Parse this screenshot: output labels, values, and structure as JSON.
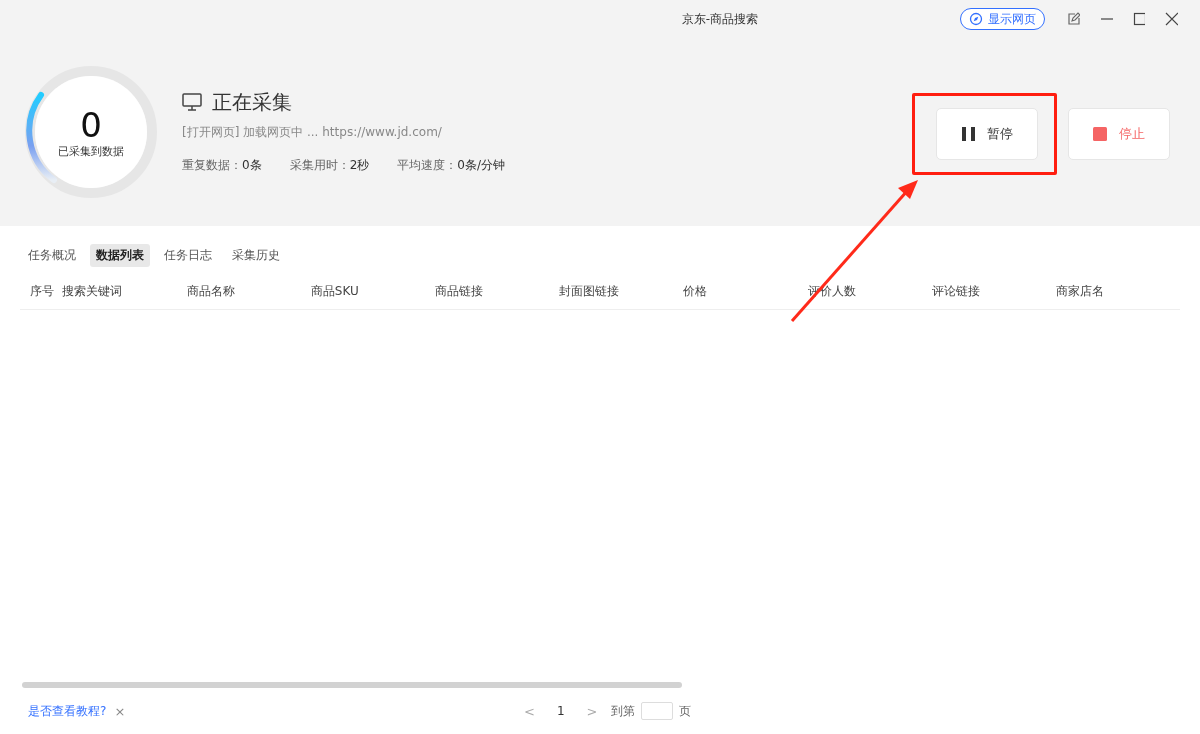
{
  "window": {
    "title": "京东-商品搜索",
    "show_page_button": "显示网页"
  },
  "status": {
    "count": "0",
    "count_label": "已采集到数据",
    "title": "正在采集",
    "detail": "[打开网页] 加载网页中 ... https://www.jd.com/",
    "stats": [
      {
        "label": "重复数据：",
        "value": "0条"
      },
      {
        "label": "采集用时：",
        "value": "2秒"
      },
      {
        "label": "平均速度：",
        "value": "0条/分钟"
      }
    ]
  },
  "actions": [
    {
      "kind": "pause",
      "label": "暂停",
      "highlighted": true
    },
    {
      "kind": "stop",
      "label": "停止",
      "highlighted": false
    }
  ],
  "tabs": [
    {
      "label": "任务概况",
      "selected": false
    },
    {
      "label": "数据列表",
      "selected": true
    },
    {
      "label": "任务日志",
      "selected": false
    },
    {
      "label": "采集历史",
      "selected": false
    }
  ],
  "table": {
    "columns": [
      "序号",
      "搜索关键词",
      "商品名称",
      "商品SKU",
      "商品链接",
      "封面图链接",
      "价格",
      "评价人数",
      "评论链接",
      "商家店名"
    ]
  },
  "footer": {
    "tutorial_link": "是否查看教程?",
    "close": "×",
    "prev": "<",
    "page": "1",
    "next": ">",
    "goto_label": "到第",
    "page_unit": "页"
  }
}
